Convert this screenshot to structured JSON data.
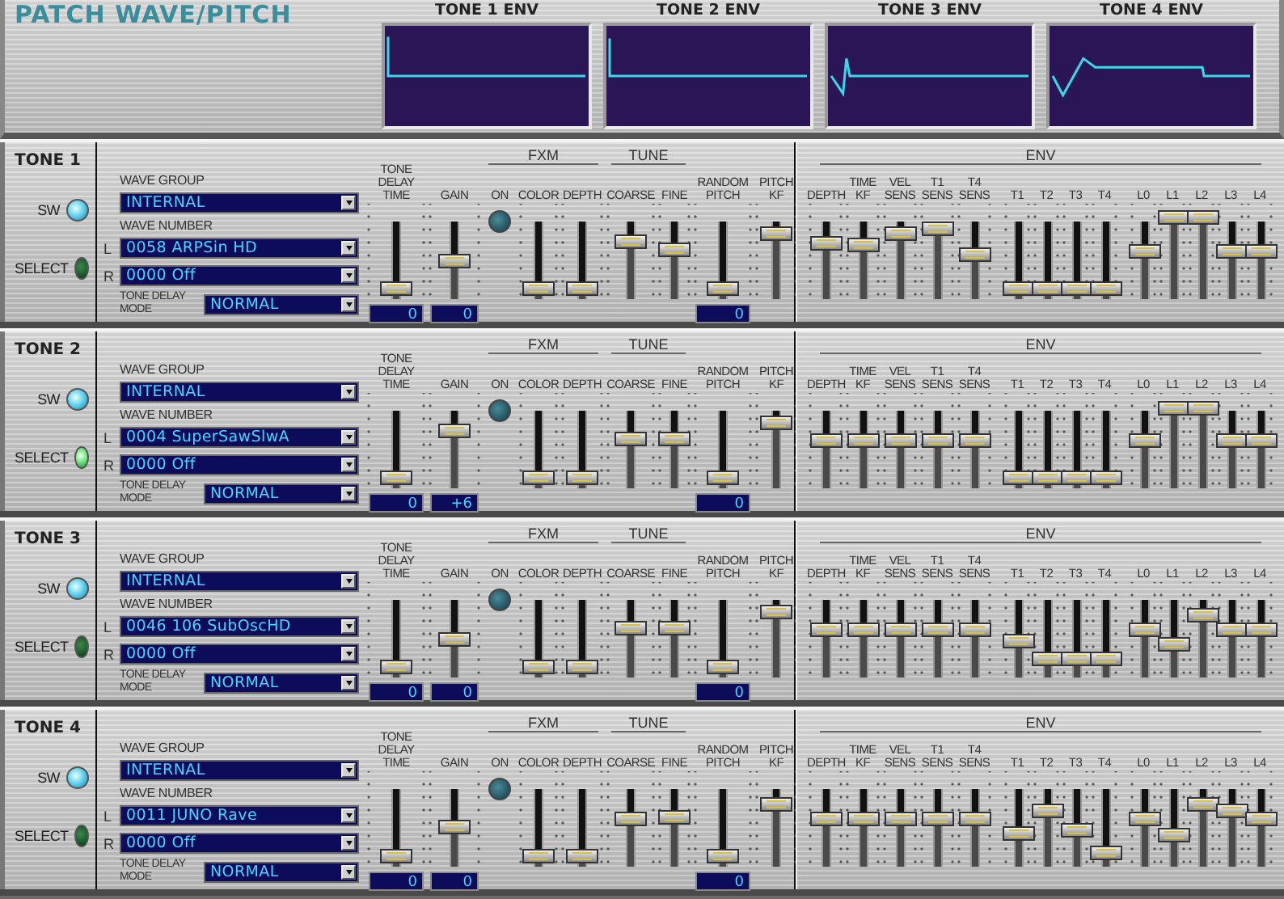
{
  "title": "PATCH WAVE/PITCH",
  "env_displays": [
    {
      "title": "TONE 1 ENV"
    },
    {
      "title": "TONE 2 ENV"
    },
    {
      "title": "TONE 3 ENV"
    },
    {
      "title": "TONE 4 ENV"
    }
  ],
  "tones": [
    {
      "label": "TONE 1",
      "sw_label": "SW",
      "sw_on": true,
      "select_label": "SELECT",
      "selected": false,
      "wave_group_label": "WAVE GROUP",
      "wave_group": "INTERNAL",
      "wave_number_label": "WAVE NUMBER",
      "l_label": "L",
      "wave_l": "0058 ARPSin HD",
      "r_label": "R",
      "wave_r": "0000 Off",
      "delay_mode_label": "TONE DELAY MODE",
      "delay_mode": "NORMAL",
      "tone_delay_time": {
        "label": "TONE DELAY TIME",
        "level": 0,
        "value": "0"
      },
      "gain": {
        "label": "GAIN",
        "level": 0.36,
        "value": "0"
      },
      "fxm": {
        "heading": "FXM",
        "on_label": "ON",
        "on": false,
        "sliders": [
          {
            "label": "COLOR",
            "level": 0
          },
          {
            "label": "DEPTH",
            "level": 0
          }
        ]
      },
      "tune": {
        "heading": "TUNE",
        "sliders": [
          {
            "label": "COARSE",
            "level": 0.64
          },
          {
            "label": "FINE",
            "level": 0.52
          }
        ]
      },
      "random_pitch": {
        "label": "RANDOM PITCH",
        "level": 0,
        "value": "0"
      },
      "pitch_kf": {
        "label": "PITCH KF",
        "level": 0.73
      },
      "env": {
        "heading": "ENV",
        "sliders": [
          {
            "label": "DEPTH",
            "level": 0.6
          },
          {
            "label": "TIME KF",
            "level": 0.58
          },
          {
            "label": "VEL SENS",
            "level": 0.73
          },
          {
            "label": "T1 SENS",
            "level": 0.8
          },
          {
            "label": "T4 SENS",
            "level": 0.45
          },
          {
            "label": "T1",
            "level": 0
          },
          {
            "label": "T2",
            "level": 0
          },
          {
            "label": "T3",
            "level": 0
          },
          {
            "label": "T4",
            "level": 0
          },
          {
            "label": "L0",
            "level": 0.5
          },
          {
            "label": "L1",
            "level": 0.95
          },
          {
            "label": "L2",
            "level": 0.95
          },
          {
            "label": "L3",
            "level": 0.5
          },
          {
            "label": "L4",
            "level": 0.5
          }
        ]
      }
    },
    {
      "label": "TONE 2",
      "sw_label": "SW",
      "sw_on": true,
      "select_label": "SELECT",
      "selected": true,
      "wave_group_label": "WAVE GROUP",
      "wave_group": "INTERNAL",
      "wave_number_label": "WAVE NUMBER",
      "l_label": "L",
      "wave_l": "0004 SuperSawSlwA",
      "r_label": "R",
      "wave_r": "0000 Off",
      "delay_mode_label": "TONE DELAY MODE",
      "delay_mode": "NORMAL",
      "tone_delay_time": {
        "label": "TONE DELAY TIME",
        "level": 0,
        "value": "0"
      },
      "gain": {
        "label": "GAIN",
        "level": 0.64,
        "value": "+6"
      },
      "fxm": {
        "heading": "FXM",
        "on_label": "ON",
        "on": false,
        "sliders": [
          {
            "label": "COLOR",
            "level": 0
          },
          {
            "label": "DEPTH",
            "level": 0
          }
        ]
      },
      "tune": {
        "heading": "TUNE",
        "sliders": [
          {
            "label": "COARSE",
            "level": 0.53
          },
          {
            "label": "FINE",
            "level": 0.53
          }
        ]
      },
      "random_pitch": {
        "label": "RANDOM PITCH",
        "level": 0,
        "value": "0"
      },
      "pitch_kf": {
        "label": "PITCH KF",
        "level": 0.73
      },
      "env": {
        "heading": "ENV",
        "sliders": [
          {
            "label": "DEPTH",
            "level": 0.5
          },
          {
            "label": "TIME KF",
            "level": 0.5
          },
          {
            "label": "VEL SENS",
            "level": 0.5
          },
          {
            "label": "T1 SENS",
            "level": 0.5
          },
          {
            "label": "T4 SENS",
            "level": 0.5
          },
          {
            "label": "T1",
            "level": 0
          },
          {
            "label": "T2",
            "level": 0
          },
          {
            "label": "T3",
            "level": 0
          },
          {
            "label": "T4",
            "level": 0
          },
          {
            "label": "L0",
            "level": 0.5
          },
          {
            "label": "L1",
            "level": 0.93
          },
          {
            "label": "L2",
            "level": 0.93
          },
          {
            "label": "L3",
            "level": 0.5
          },
          {
            "label": "L4",
            "level": 0.5
          }
        ]
      }
    },
    {
      "label": "TONE 3",
      "sw_label": "SW",
      "sw_on": true,
      "select_label": "SELECT",
      "selected": false,
      "wave_group_label": "WAVE GROUP",
      "wave_group": "INTERNAL",
      "wave_number_label": "WAVE NUMBER",
      "l_label": "L",
      "wave_l": "0046 106 SubOscHD",
      "r_label": "R",
      "wave_r": "0000 Off",
      "delay_mode_label": "TONE DELAY MODE",
      "delay_mode": "NORMAL",
      "tone_delay_time": {
        "label": "TONE DELAY TIME",
        "level": 0,
        "value": "0"
      },
      "gain": {
        "label": "GAIN",
        "level": 0.36,
        "value": "0"
      },
      "fxm": {
        "heading": "FXM",
        "on_label": "ON",
        "on": false,
        "sliders": [
          {
            "label": "COLOR",
            "level": 0
          },
          {
            "label": "DEPTH",
            "level": 0
          }
        ]
      },
      "tune": {
        "heading": "TUNE",
        "sliders": [
          {
            "label": "COARSE",
            "level": 0.53
          },
          {
            "label": "FINE",
            "level": 0.53
          }
        ]
      },
      "random_pitch": {
        "label": "RANDOM PITCH",
        "level": 0,
        "value": "0"
      },
      "pitch_kf": {
        "label": "PITCH KF",
        "level": 0.73
      },
      "env": {
        "heading": "ENV",
        "sliders": [
          {
            "label": "DEPTH",
            "level": 0.5
          },
          {
            "label": "TIME KF",
            "level": 0.5
          },
          {
            "label": "VEL SENS",
            "level": 0.5
          },
          {
            "label": "T1 SENS",
            "level": 0.5
          },
          {
            "label": "T4 SENS",
            "level": 0.5
          },
          {
            "label": "T1",
            "level": 0.35
          },
          {
            "label": "T2",
            "level": 0.1
          },
          {
            "label": "T3",
            "level": 0.1
          },
          {
            "label": "T4",
            "level": 0.1
          },
          {
            "label": "L0",
            "level": 0.5
          },
          {
            "label": "L1",
            "level": 0.3
          },
          {
            "label": "L2",
            "level": 0.7
          },
          {
            "label": "L3",
            "level": 0.5
          },
          {
            "label": "L4",
            "level": 0.5
          }
        ]
      }
    },
    {
      "label": "TONE 4",
      "sw_label": "SW",
      "sw_on": true,
      "select_label": "SELECT",
      "selected": false,
      "wave_group_label": "WAVE GROUP",
      "wave_group": "INTERNAL",
      "wave_number_label": "WAVE NUMBER",
      "l_label": "L",
      "wave_l": "0011 JUNO Rave",
      "r_label": "R",
      "wave_r": "0000 Off",
      "delay_mode_label": "TONE DELAY MODE",
      "delay_mode": "NORMAL",
      "tone_delay_time": {
        "label": "TONE DELAY TIME",
        "level": 0,
        "value": "0"
      },
      "gain": {
        "label": "GAIN",
        "level": 0.4,
        "value": "0"
      },
      "fxm": {
        "heading": "FXM",
        "on_label": "ON",
        "on": false,
        "sliders": [
          {
            "label": "COLOR",
            "level": 0
          },
          {
            "label": "DEPTH",
            "level": 0
          }
        ]
      },
      "tune": {
        "heading": "TUNE",
        "sliders": [
          {
            "label": "COARSE",
            "level": 0.5
          },
          {
            "label": "FINE",
            "level": 0.52
          }
        ]
      },
      "random_pitch": {
        "label": "RANDOM PITCH",
        "level": 0,
        "value": "0"
      },
      "pitch_kf": {
        "label": "PITCH KF",
        "level": 0.7
      },
      "env": {
        "heading": "ENV",
        "sliders": [
          {
            "label": "DEPTH",
            "level": 0.5
          },
          {
            "label": "TIME KF",
            "level": 0.5
          },
          {
            "label": "VEL SENS",
            "level": 0.5
          },
          {
            "label": "T1 SENS",
            "level": 0.5
          },
          {
            "label": "T4 SENS",
            "level": 0.5
          },
          {
            "label": "T1",
            "level": 0.3
          },
          {
            "label": "T2",
            "level": 0.6
          },
          {
            "label": "T3",
            "level": 0.35
          },
          {
            "label": "T4",
            "level": 0.05
          },
          {
            "label": "L0",
            "level": 0.5
          },
          {
            "label": "L1",
            "level": 0.28
          },
          {
            "label": "L2",
            "level": 0.7
          },
          {
            "label": "L3",
            "level": 0.6
          },
          {
            "label": "L4",
            "level": 0.5
          }
        ]
      }
    }
  ]
}
